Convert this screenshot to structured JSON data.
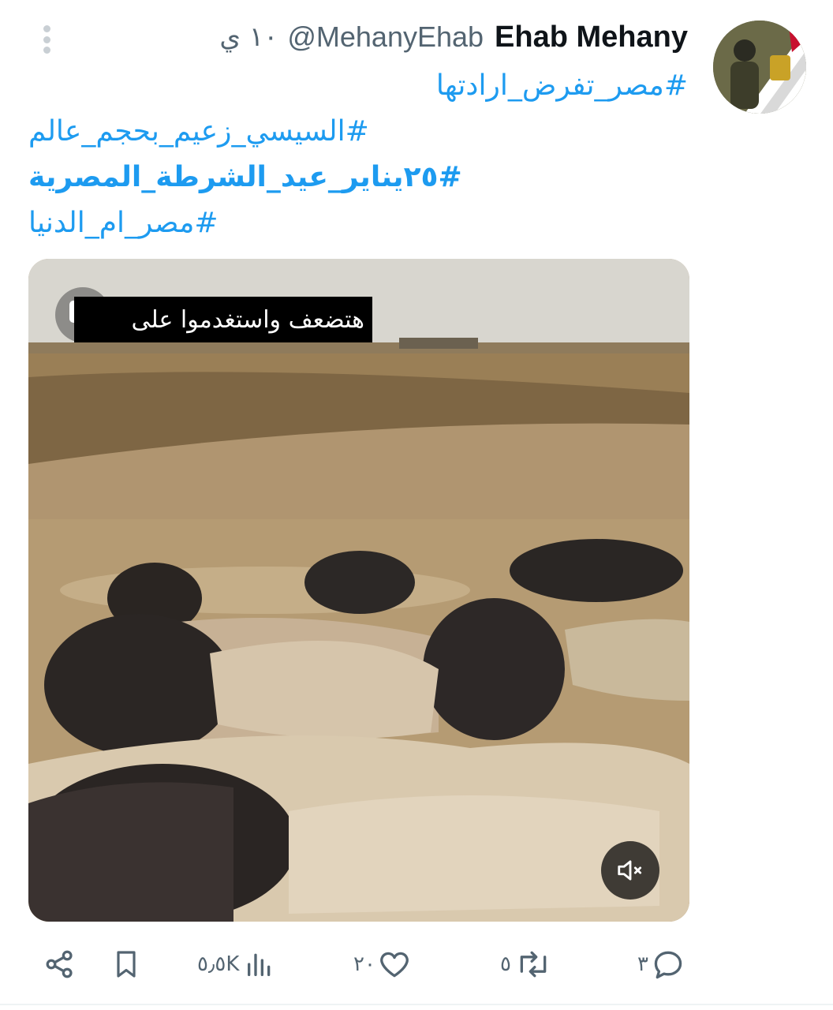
{
  "tweet": {
    "author_name": "Ehab Mehany",
    "handle": "@MehanyEhab",
    "time": "١٠ ي",
    "hashtags": [
      "#مصر_تفرض_ارادتها",
      "#السيسي_زعيم_بحجم_عالم",
      "#٢٥يناير_عيد_الشرطة_المصرية",
      "#مصر_ام_الدنيا"
    ]
  },
  "media": {
    "caption": "هتضعف واستغدموا على",
    "cc_label": "CC"
  },
  "actions": {
    "reply_count": "٣",
    "retweet_count": "٥",
    "like_count": "٢٠",
    "views_count": "٥٫٥K"
  },
  "colors": {
    "link": "#1d9bf0",
    "secondary_text": "#536471",
    "icon": "#536471"
  }
}
